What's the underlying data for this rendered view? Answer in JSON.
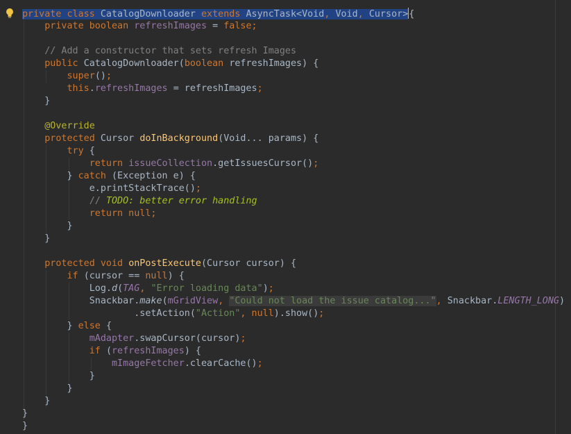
{
  "colors": {
    "background": "#2b2b2b",
    "keyword": "#cc7832",
    "method_declaration": "#ffc66d",
    "string": "#6a8759",
    "comment": "#808080",
    "todo": "#a8c023",
    "field": "#9876aa",
    "annotation": "#bbb529",
    "default_text": "#a9b7c6",
    "selection": "#214283"
  },
  "gutter": {
    "icon": "lightbulb-icon"
  },
  "lines": [
    [
      [
        "kw sel",
        "private class "
      ],
      [
        "sel",
        "CatalogDownloader "
      ],
      [
        "kw sel",
        "extends "
      ],
      [
        "sel",
        "AsyncTask<Void"
      ],
      [
        "kw sel",
        ", "
      ],
      [
        "sel",
        "Void"
      ],
      [
        "kw sel",
        ", "
      ],
      [
        "sel",
        "Cursor>"
      ],
      [
        "caret",
        ""
      ],
      [
        "",
        "{"
      ]
    ],
    [
      [
        "",
        "    "
      ],
      [
        "kw",
        "private boolean "
      ],
      [
        "fld",
        "refreshImages "
      ],
      [
        "",
        "= "
      ],
      [
        "kw",
        "false;"
      ]
    ],
    [],
    [
      [
        "",
        "    "
      ],
      [
        "cmt",
        "// Add a constructor that sets refresh Images"
      ]
    ],
    [
      [
        "",
        "    "
      ],
      [
        "kw",
        "public "
      ],
      [
        "",
        "CatalogDownloader("
      ],
      [
        "kw",
        "boolean "
      ],
      [
        "",
        "refreshImages) {"
      ]
    ],
    [
      [
        "",
        "        "
      ],
      [
        "kw",
        "super"
      ],
      [
        "",
        "()"
      ],
      [
        "kw",
        ";"
      ]
    ],
    [
      [
        "",
        "        "
      ],
      [
        "kw",
        "this"
      ],
      [
        "",
        "."
      ],
      [
        "fld",
        "refreshImages "
      ],
      [
        "",
        "= refreshImages"
      ],
      [
        "kw",
        ";"
      ]
    ],
    [
      [
        "",
        "    }"
      ]
    ],
    [],
    [
      [
        "",
        "    "
      ],
      [
        "ann",
        "@Override"
      ]
    ],
    [
      [
        "",
        "    "
      ],
      [
        "kw",
        "protected "
      ],
      [
        "",
        "Cursor "
      ],
      [
        "fn",
        "doInBackground"
      ],
      [
        "",
        "(Void... params) {"
      ]
    ],
    [
      [
        "",
        "        "
      ],
      [
        "kw",
        "try "
      ],
      [
        "",
        "{"
      ]
    ],
    [
      [
        "",
        "            "
      ],
      [
        "kw",
        "return "
      ],
      [
        "fld",
        "issueCollection"
      ],
      [
        "",
        ".getIssuesCursor()"
      ],
      [
        "kw",
        ";"
      ]
    ],
    [
      [
        "",
        "        } "
      ],
      [
        "kw",
        "catch "
      ],
      [
        "",
        "(Exception e) {"
      ]
    ],
    [
      [
        "",
        "            e.printStackTrace()"
      ],
      [
        "kw",
        ";"
      ]
    ],
    [
      [
        "",
        "            "
      ],
      [
        "cmt",
        "// "
      ],
      [
        "todo",
        "TODO: better error handling"
      ]
    ],
    [
      [
        "",
        "            "
      ],
      [
        "kw",
        "return null;"
      ]
    ],
    [
      [
        "",
        "        }"
      ]
    ],
    [
      [
        "",
        "    }"
      ]
    ],
    [],
    [
      [
        "",
        "    "
      ],
      [
        "kw",
        "protected void "
      ],
      [
        "fn",
        "onPostExecute"
      ],
      [
        "",
        "(Cursor cursor) {"
      ]
    ],
    [
      [
        "",
        "        "
      ],
      [
        "kw",
        "if "
      ],
      [
        "",
        "(cursor == "
      ],
      [
        "kw",
        "null"
      ],
      [
        "",
        ") {"
      ]
    ],
    [
      [
        "",
        "            Log."
      ],
      [
        "smeth",
        "d"
      ],
      [
        "",
        "("
      ],
      [
        "sfld",
        "TAG"
      ],
      [
        "kw",
        ", "
      ],
      [
        "str",
        "\"Error loading data\""
      ],
      [
        "",
        ")"
      ],
      [
        "kw",
        ";"
      ]
    ],
    [
      [
        "",
        "            Snackbar."
      ],
      [
        "smeth",
        "make"
      ],
      [
        "",
        "("
      ],
      [
        "fld",
        "mGridView"
      ],
      [
        "kw",
        ", "
      ],
      [
        "str hl",
        "\"Could not load the issue catalog...\""
      ],
      [
        "kw",
        ", "
      ],
      [
        "",
        "Snackbar."
      ],
      [
        "sfld",
        "LENGTH_LONG"
      ],
      [
        "",
        ")"
      ]
    ],
    [
      [
        "",
        "                    .setAction("
      ],
      [
        "str",
        "\"Action\""
      ],
      [
        "kw",
        ", "
      ],
      [
        "kw",
        "null"
      ],
      [
        "",
        ").show()"
      ],
      [
        "kw",
        ";"
      ]
    ],
    [
      [
        "",
        "        } "
      ],
      [
        "kw",
        "else "
      ],
      [
        "",
        "{"
      ]
    ],
    [
      [
        "",
        "            "
      ],
      [
        "fld",
        "mAdapter"
      ],
      [
        "",
        ".swapCursor(cursor)"
      ],
      [
        "kw",
        ";"
      ]
    ],
    [
      [
        "",
        "            "
      ],
      [
        "kw",
        "if "
      ],
      [
        "",
        "("
      ],
      [
        "fld",
        "refreshImages"
      ],
      [
        "",
        ") {"
      ]
    ],
    [
      [
        "",
        "                "
      ],
      [
        "fld",
        "mImageFetcher"
      ],
      [
        "",
        ".clearCache()"
      ],
      [
        "kw",
        ";"
      ]
    ],
    [
      [
        "",
        "            }"
      ]
    ],
    [
      [
        "",
        "        }"
      ]
    ],
    [
      [
        "",
        "    }"
      ]
    ],
    [
      [
        "",
        "}"
      ]
    ],
    [
      [
        "",
        "}"
      ]
    ]
  ]
}
